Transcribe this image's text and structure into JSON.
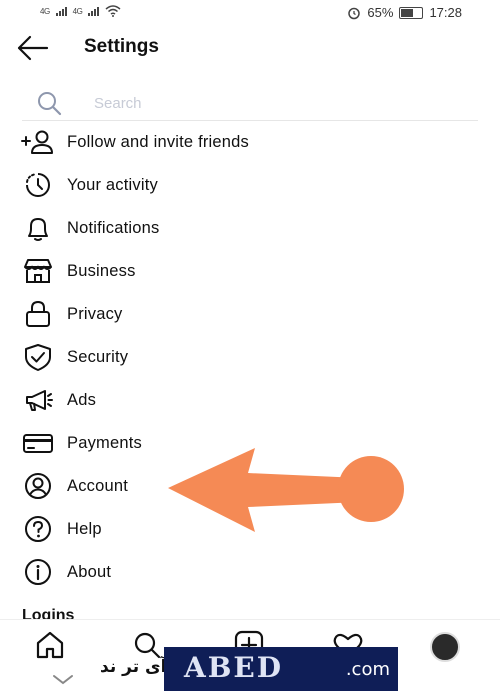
{
  "status_bar": {
    "network_1": "4G",
    "network_2": "4G",
    "battery": "65%",
    "time": "17:28"
  },
  "header": {
    "title": "Settings"
  },
  "search": {
    "placeholder": "Search"
  },
  "menu": [
    {
      "label": "Follow and invite friends",
      "icon": "add-person-icon"
    },
    {
      "label": "Your activity",
      "icon": "activity-clock-icon"
    },
    {
      "label": "Notifications",
      "icon": "bell-icon"
    },
    {
      "label": "Business",
      "icon": "store-icon"
    },
    {
      "label": "Privacy",
      "icon": "lock-icon"
    },
    {
      "label": "Security",
      "icon": "shield-check-icon"
    },
    {
      "label": "Ads",
      "icon": "megaphone-icon"
    },
    {
      "label": "Payments",
      "icon": "credit-card-icon"
    },
    {
      "label": "Account",
      "icon": "account-circle-icon"
    },
    {
      "label": "Help",
      "icon": "help-icon"
    },
    {
      "label": "About",
      "icon": "info-icon"
    }
  ],
  "section": {
    "logins": "Logins"
  },
  "bottom_nav": [
    "home-icon",
    "search-icon",
    "create-post-icon",
    "heart-icon",
    "profile-avatar"
  ],
  "annotation": {
    "arrow_color": "#f58a55"
  },
  "watermark": {
    "arabic": "آی تر ند",
    "dotcom": ".com"
  }
}
